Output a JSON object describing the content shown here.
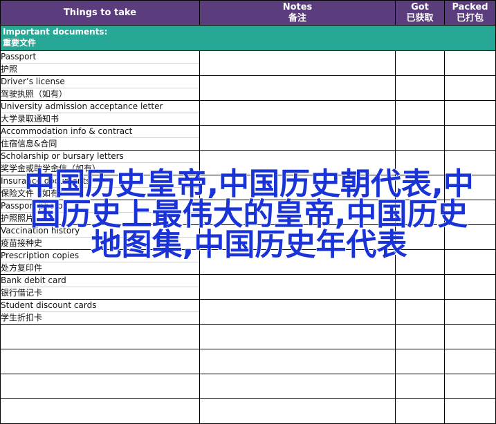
{
  "header": {
    "things_to_take": "Things to take",
    "notes_en": "Notes",
    "notes_zh": "备注",
    "got_en": "Got",
    "got_zh": "已获取",
    "packed_en": "Packed",
    "packed_zh": "已打包"
  },
  "section": {
    "title_en": "Important documents:",
    "title_zh": "重要文件"
  },
  "items": [
    {
      "en": "Passport",
      "zh": "护照"
    },
    {
      "en": "Driver’s license",
      "zh": "驾驶执照（如有）"
    },
    {
      "en": "University admission acceptance letter",
      "zh": "大学录取通知书"
    },
    {
      "en": "Accommodation info & contract",
      "zh": "住宿信息&合同"
    },
    {
      "en": "Scholarship or bursary letters",
      "zh": "奖学金或助学金信（如有）"
    },
    {
      "en": "Insurance documents",
      "zh": "保险文件（如有）"
    },
    {
      "en": "Passport photos",
      "zh": "护照照片"
    },
    {
      "en": "Vaccination history",
      "zh": "疫苗接种史"
    },
    {
      "en": "Prescription copies",
      "zh": "处方复印件"
    },
    {
      "en": "Bank debit card",
      "zh": "银行借记卡"
    },
    {
      "en": "Student discount cards",
      "zh": "学生折扣卡"
    }
  ],
  "watermark": "中国历史皇帝,中国历史朝代表,中国历史上最伟大的皇帝,中国历史地图集,中国历史年代表",
  "colors": {
    "header_bg": "#5b3d7e",
    "section_bg": "#27a896",
    "watermark": "#1a33d6"
  }
}
